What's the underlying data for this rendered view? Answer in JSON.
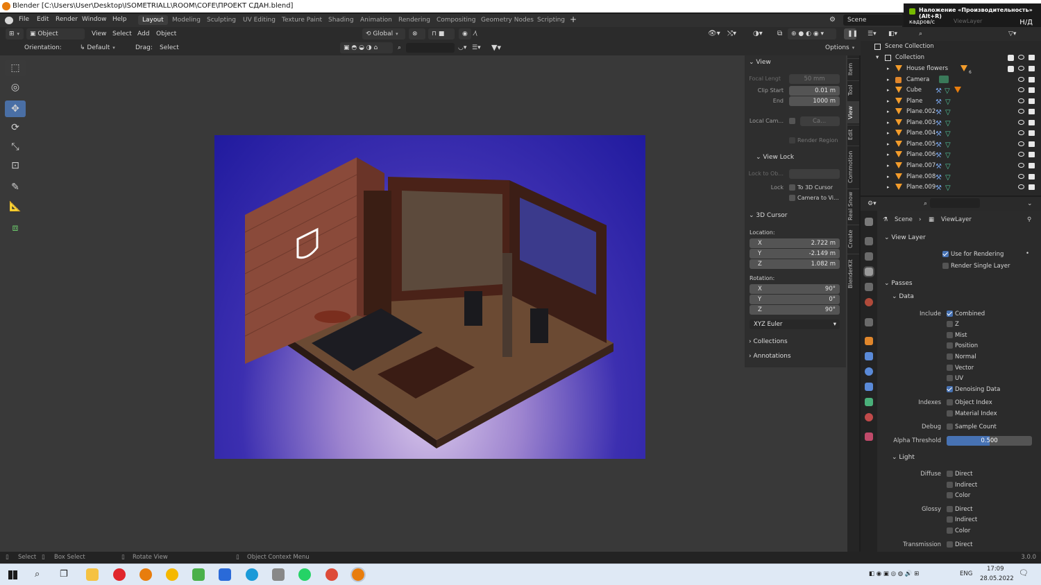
{
  "window": {
    "title": "Blender [C:\\Users\\User\\Desktop\\ISOMETRIALL\\ROOM\\COFE\\ПРОЕКТ СДАН.blend]"
  },
  "overlay": {
    "title": "Наложение «Производительность» (Alt+R)",
    "fps_label": "кадров/с",
    "fps_value": "Н/Д",
    "viewlayer": "ViewLayer"
  },
  "menu": {
    "file": "File",
    "edit": "Edit",
    "render": "Render",
    "window": "Window",
    "help": "Help"
  },
  "workspaces": [
    "Layout",
    "Modeling",
    "Sculpting",
    "UV Editing",
    "Texture Paint",
    "Shading",
    "Animation",
    "Rendering",
    "Compositing",
    "Geometry Nodes",
    "Scripting"
  ],
  "scene_name": "Scene",
  "header": {
    "mode": "Object Mode",
    "view": "View",
    "select": "Select",
    "add": "Add",
    "object": "Object",
    "transform": "Global",
    "options": "Options"
  },
  "header2": {
    "orientation_label": "Orientation:",
    "orientation": "Default",
    "drag_label": "Drag:",
    "drag": "Select Box"
  },
  "npanel": {
    "view_title": "View",
    "focal_label": "Focal Lengt",
    "focal_value": "50 mm",
    "clip_start_label": "Clip Start",
    "clip_start": "0.01 m",
    "clip_end_label": "End",
    "clip_end": "1000 m",
    "local_cam_label": "Local Cam...",
    "local_cam_value": "Ca...",
    "render_region": "Render Region",
    "view_lock_title": "View Lock",
    "lock_to_obj_label": "Lock to Ob...",
    "lock_label": "Lock",
    "to_cursor": "To 3D Cursor",
    "camera_to_view": "Camera to Vi...",
    "cursor_title": "3D Cursor",
    "location_label": "Location:",
    "loc_x": "2.722 m",
    "loc_y": "-2.149 m",
    "loc_z": "1.082 m",
    "rotation_label": "Rotation:",
    "rot_x": "90°",
    "rot_y": "0°",
    "rot_z": "90°",
    "rot_mode": "XYZ Euler",
    "collections": "Collections",
    "annotations": "Annotations",
    "axis_x": "X",
    "axis_y": "Y",
    "axis_z": "Z"
  },
  "sidetabs": [
    "Item",
    "Tool",
    "View",
    "Edit",
    "Commotion",
    "Real Snow",
    "Create",
    "BlenderKit"
  ],
  "outliner": {
    "scene_collection": "Scene Collection",
    "collection": "Collection",
    "items": [
      "House flowers",
      "Camera",
      "Cube",
      "Plane",
      "Plane.002",
      "Plane.003",
      "Plane.004",
      "Plane.005",
      "Plane.006",
      "Plane.007",
      "Plane.008",
      "Plane.009"
    ],
    "badge": "6"
  },
  "properties": {
    "breadcrumb_scene": "Scene",
    "breadcrumb_layer": "ViewLayer",
    "view_layer_title": "View Layer",
    "use_for_rendering": "Use for Rendering",
    "render_single_layer": "Render Single Layer",
    "passes_title": "Passes",
    "data_title": "Data",
    "include_label": "Include",
    "combined": "Combined",
    "z": "Z",
    "mist": "Mist",
    "position": "Position",
    "normal": "Normal",
    "vector": "Vector",
    "uv": "UV",
    "denoising": "Denoising Data",
    "indexes_label": "Indexes",
    "object_index": "Object Index",
    "material_index": "Material Index",
    "debug_label": "Debug",
    "sample_count": "Sample Count",
    "alpha_label": "Alpha Threshold",
    "alpha_value": "0.500",
    "alpha_fraction": 0.5,
    "light_title": "Light",
    "diffuse_label": "Diffuse",
    "glossy_label": "Glossy",
    "transmission_label": "Transmission",
    "direct": "Direct",
    "indirect": "Indirect",
    "color": "Color"
  },
  "status": {
    "select": "Select",
    "box_select": "Box Select",
    "rotate_view": "Rotate View",
    "context_menu": "Object Context Menu",
    "version": "3.0.0"
  },
  "taskbar": {
    "lang": "ENG",
    "time": "17:09",
    "date": "28.05.2022"
  }
}
